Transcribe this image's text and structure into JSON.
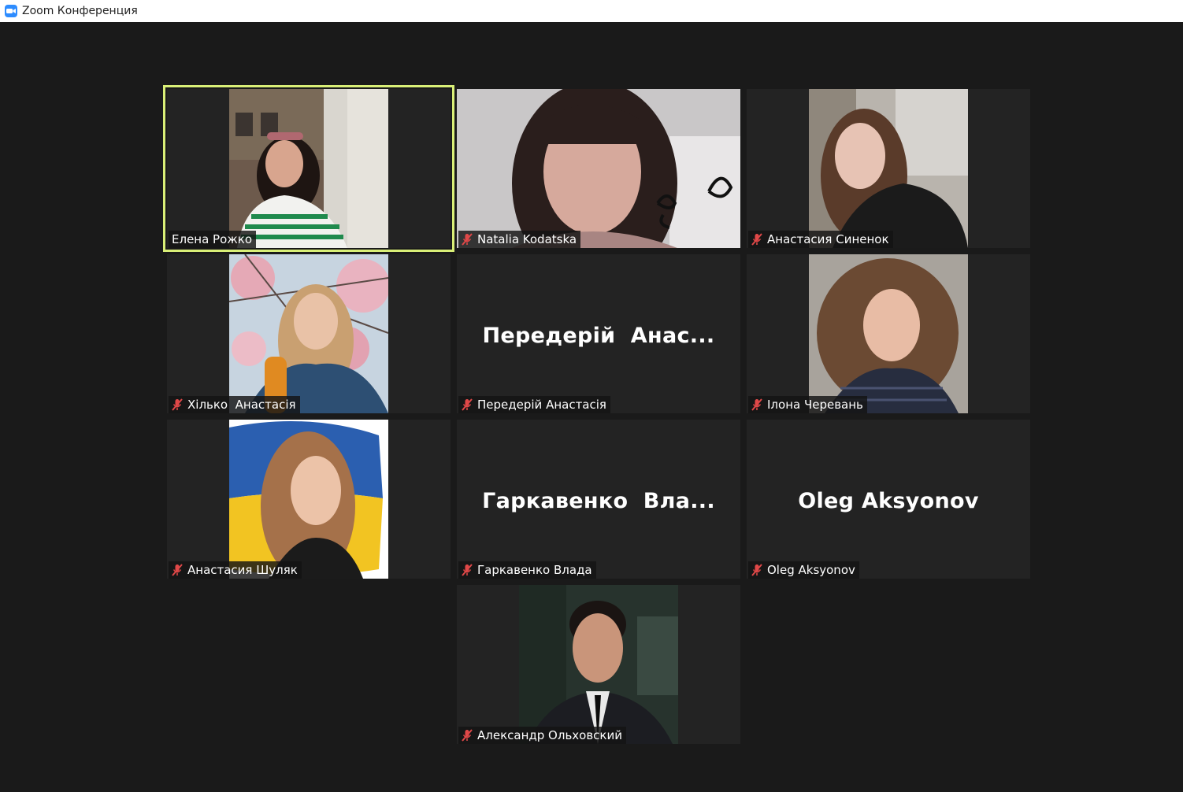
{
  "window": {
    "title": "Zoom Конференция",
    "app_icon": "zoom-camera-icon",
    "accent": "#2d8cff"
  },
  "active_speaker_color": "#d9ef77",
  "participants": [
    {
      "name": "Елена Рожко",
      "muted": false,
      "big_name": ""
    },
    {
      "name": "Natalia Kodatska",
      "muted": true,
      "big_name": ""
    },
    {
      "name": "Анастасия Синенок",
      "muted": true,
      "big_name": ""
    },
    {
      "name": "Хілько  Анастасія",
      "muted": true,
      "big_name": ""
    },
    {
      "name": "Передерій Анастасія",
      "muted": true,
      "big_name": "Передерій  Анас..."
    },
    {
      "name": "Ілона Черевань",
      "muted": true,
      "big_name": ""
    },
    {
      "name": "Анастасия Шуляк",
      "muted": true,
      "big_name": ""
    },
    {
      "name": "Гаркавенко Влада",
      "muted": true,
      "big_name": "Гаркавенко  Вла..."
    },
    {
      "name": "Oleg Aksyonov",
      "muted": true,
      "big_name": "Oleg Aksyonov"
    },
    {
      "name": "Александр Ольховский",
      "muted": true,
      "big_name": ""
    }
  ],
  "icons": {
    "muted": "mic-muted-icon"
  }
}
